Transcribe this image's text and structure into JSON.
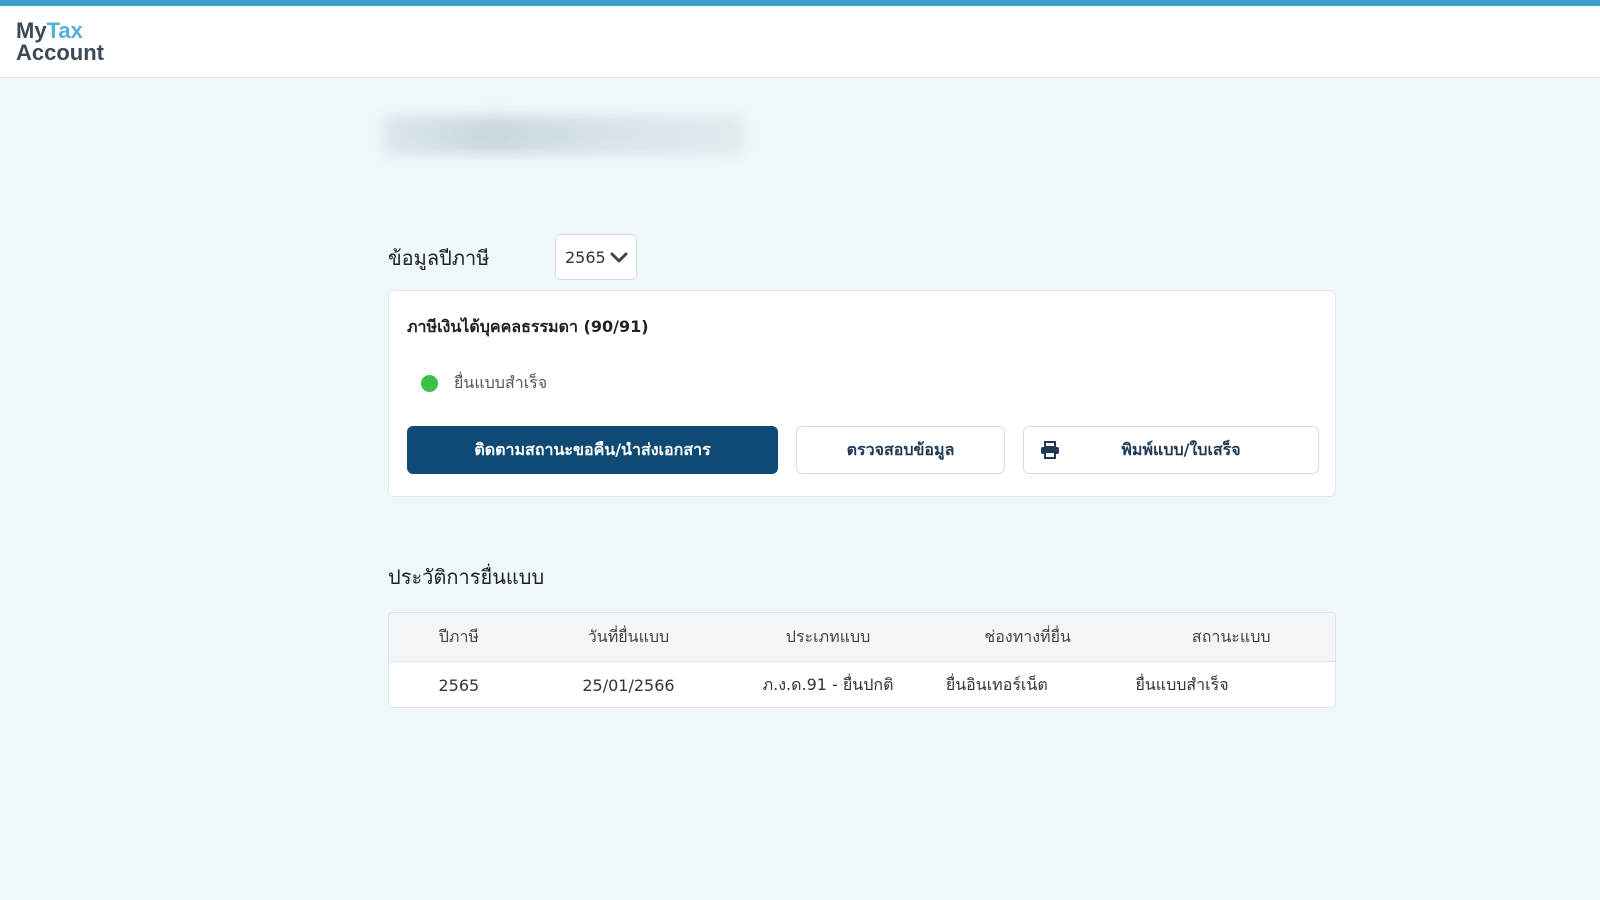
{
  "app": {
    "logo_line1_my": "My",
    "logo_line1_tax": "Tax",
    "logo_line2": "Account"
  },
  "tax_year_section": {
    "title": "ข้อมูลปีภาษี",
    "selected_year": "2565"
  },
  "tax_card": {
    "title": "ภาษีเงินได้บุคคลธรรมดา (90/91)",
    "status_text": "ยื่นแบบสำเร็จ",
    "status_color": "#3cc04a",
    "buttons": {
      "track_refund": "ติดตามสถานะขอคืน/นำส่งเอกสาร",
      "verify_info": "ตรวจสอบข้อมูล",
      "print_form": "พิมพ์แบบ/ใบเสร็จ"
    }
  },
  "history": {
    "title": "ประวัติการยื่นแบบ",
    "columns": [
      "ปีภาษี",
      "วันที่ยื่นแบบ",
      "ประเภทแบบ",
      "ช่องทางที่ยื่น",
      "สถานะแบบ"
    ],
    "rows": [
      [
        "2565",
        "25/01/2566",
        "ภ.ง.ด.91 - ยื่นปกติ",
        "ยื่นอินเทอร์เน็ต",
        "ยื่นแบบสำเร็จ"
      ]
    ]
  },
  "colors": {
    "accent": "#3aa0c9",
    "primary_button": "#0e4a73",
    "background": "#eef7fa"
  }
}
